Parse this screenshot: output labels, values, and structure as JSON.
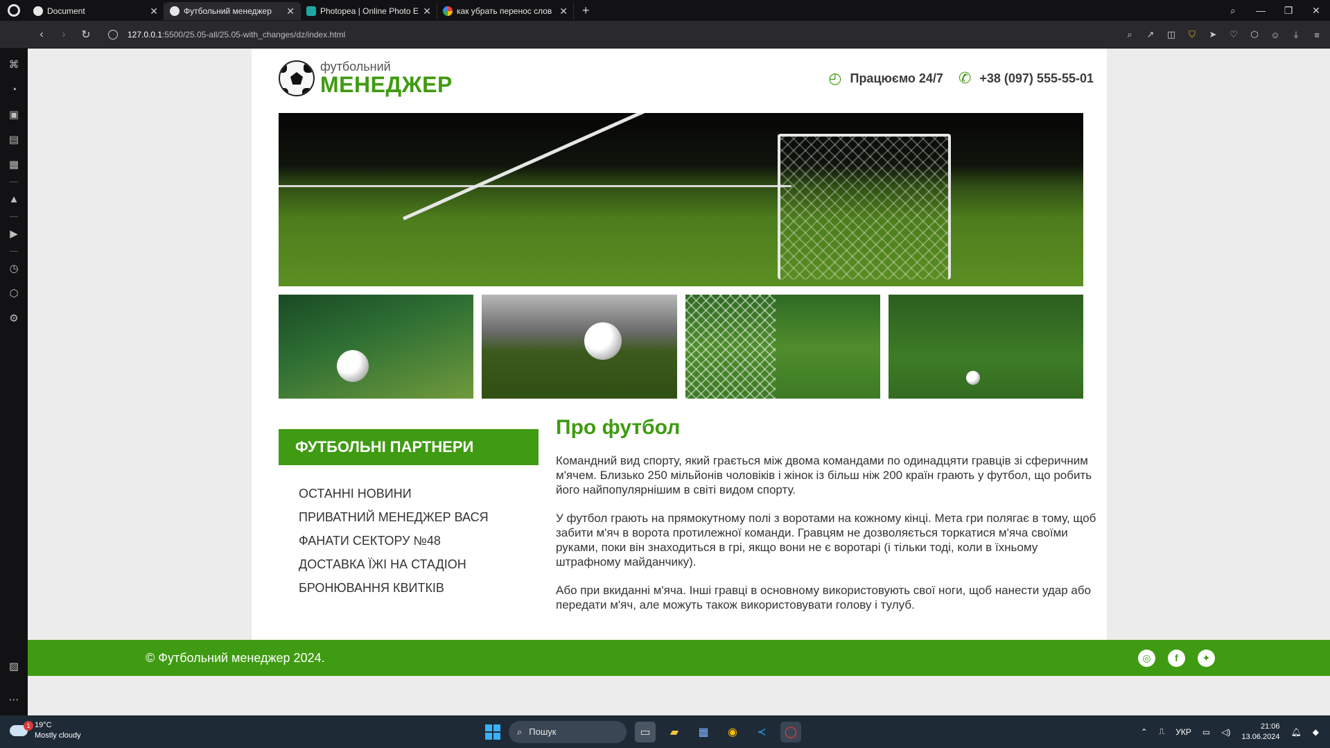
{
  "browser": {
    "tabs": [
      {
        "title": "Document",
        "active": false
      },
      {
        "title": "Футбольний менеджер",
        "active": true
      },
      {
        "title": "Photopea | Online Photo Ed",
        "active": false
      },
      {
        "title": "как убрать перенос слов",
        "active": false
      }
    ],
    "url_host": "127.0.0.1",
    "url_path": ":5500/25.05-all/25.05-with_changes/dz/index.html"
  },
  "site": {
    "logo_small": "футбольний",
    "logo_big": "МЕНЕДЖЕР",
    "hours": "Працюємо 24/7",
    "phone": "+38 (097) 555-55-01",
    "partners_title": "ФУТБОЛЬНІ ПАРТНЕРИ",
    "partners": [
      "Останні новини",
      "Приватний менеджер Вася",
      "Фанати сектору №48",
      "Доставка їжі на стадіон",
      "Бронювання квитків"
    ],
    "article_title": "Про футбол",
    "paragraphs": [
      "Командний вид спорту, який грається між двома командами по одинадцяти гравців зі сферичним м'ячем. Близько 250 мільйонів чоловіків і жінок із більш ніж 200 країн грають у футбол, що робить його найпопулярнішим в світі видом спорту.",
      "У футбол грають на прямокутному полі з воротами на кожному кінці. Мета гри полягає в тому, щоб забити м'яч в ворота протилежної команди. Гравцям не дозволяється торкатися м'яча своїми руками, поки він знаходиться в грі, якщо вони не є воротарі (і тільки тоді, коли в їхньому штрафному майданчику).",
      "Або при вкиданні м'яча. Інші гравці в основному використовують свої ноги, щоб нанести удар або передати м'яч, але можуть також використовувати голову і тулуб."
    ],
    "footer_copy": "© Футбольний менеджер 2024.",
    "accent_color": "#3f9b11"
  },
  "taskbar": {
    "weather_temp": "19°C",
    "weather_desc": "Mostly cloudy",
    "weather_badge": "1",
    "search_placeholder": "Пошук",
    "lang": "УКР",
    "time": "21:06",
    "date": "13.06.2024"
  }
}
